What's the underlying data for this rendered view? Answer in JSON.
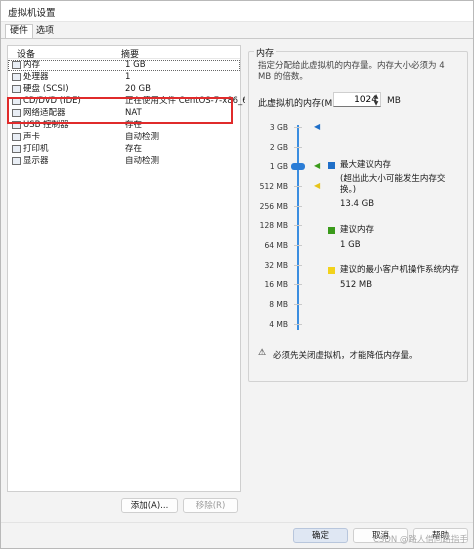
{
  "window": {
    "title": "虚拟机设置"
  },
  "tabs": [
    {
      "label": "硬件"
    },
    {
      "label": "选项"
    }
  ],
  "device_list": {
    "headers": {
      "device": "设备",
      "summary": "摘要"
    },
    "rows": [
      {
        "icon": "memory-icon",
        "name": "内存",
        "summary": "1 GB"
      },
      {
        "icon": "processor-icon",
        "name": "处理器",
        "summary": "1"
      },
      {
        "icon": "hard-disk-icon",
        "name": "硬盘 (SCSI)",
        "summary": "20 GB"
      },
      {
        "icon": "cd-dvd-icon",
        "name": "CD/DVD (IDE)",
        "summary": "正在使用文件 CentOS-7-x86_6..."
      },
      {
        "icon": "network-adapter-icon",
        "name": "网络适配器",
        "summary": "NAT"
      },
      {
        "icon": "usb-controller-icon",
        "name": "USB 控制器",
        "summary": "存在"
      },
      {
        "icon": "sound-card-icon",
        "name": "声卡",
        "summary": "自动检测"
      },
      {
        "icon": "printer-icon",
        "name": "打印机",
        "summary": "存在"
      },
      {
        "icon": "display-icon",
        "name": "显示器",
        "summary": "自动检测"
      }
    ],
    "add_button": "添加(A)...",
    "remove_button": "移除(R)"
  },
  "memory_panel": {
    "group_title": "内存",
    "description": "指定分配给此虚拟机的内存量。内存大小必须为 4 MB 的倍数。",
    "input_label": "此虚拟机的内存(M):",
    "input_value": "1024",
    "unit": "MB",
    "scale_labels": [
      "3 GB",
      "2 GB",
      "1 GB",
      "512 MB",
      "256 MB",
      "128 MB",
      "64 MB",
      "32 MB",
      "16 MB",
      "8 MB",
      "4 MB"
    ],
    "legend": {
      "max_recommended": {
        "label": "最大建议内存",
        "note": "(超出此大小可能发生内存交换。)",
        "value": "13.4 GB",
        "color": "#1f6fc8"
      },
      "recommended": {
        "label": "建议内存",
        "value": "1 GB",
        "color": "#3a9a1a"
      },
      "guest_min": {
        "label": "建议的最小客户机操作系统内存",
        "value": "512 MB",
        "color": "#f2d21b"
      }
    },
    "warning": "必须先关闭虚拟机，才能降低内存量。"
  },
  "footer": {
    "ok": "确定",
    "cancel": "取消",
    "help": "帮助"
  },
  "watermark": "CSDN @路人借问路指手"
}
